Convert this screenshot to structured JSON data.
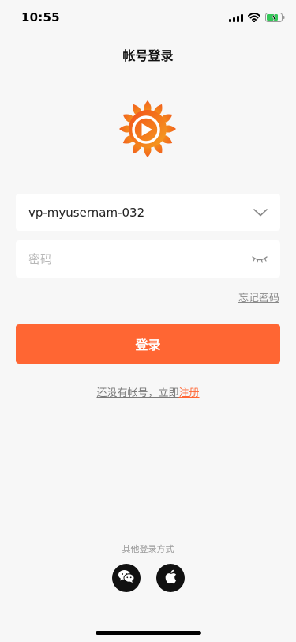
{
  "status_bar": {
    "time": "10:55",
    "icons": [
      "cellular-signal-icon",
      "wifi-icon",
      "battery-charging-icon"
    ]
  },
  "page": {
    "title": "帐号登录"
  },
  "logo": {
    "icon": "sunflower-play-logo-icon",
    "colors": [
      "#f2611d",
      "#f4a21d"
    ]
  },
  "form": {
    "username": {
      "value": "vp-myusernam-032",
      "dropdown_icon": "chevron-down-icon"
    },
    "password": {
      "placeholder": "密码",
      "toggle_icon": "closed-eye-icon"
    },
    "forgot_password": "忘记密码",
    "login_button": "登录"
  },
  "register": {
    "prompt": "还没有帐号，立即",
    "link": "注册"
  },
  "other_login": {
    "label": "其他登录方式",
    "methods": [
      "wechat-icon",
      "apple-icon"
    ]
  },
  "theme": {
    "accent": "#ff6633",
    "background": "#f7f7f7"
  }
}
